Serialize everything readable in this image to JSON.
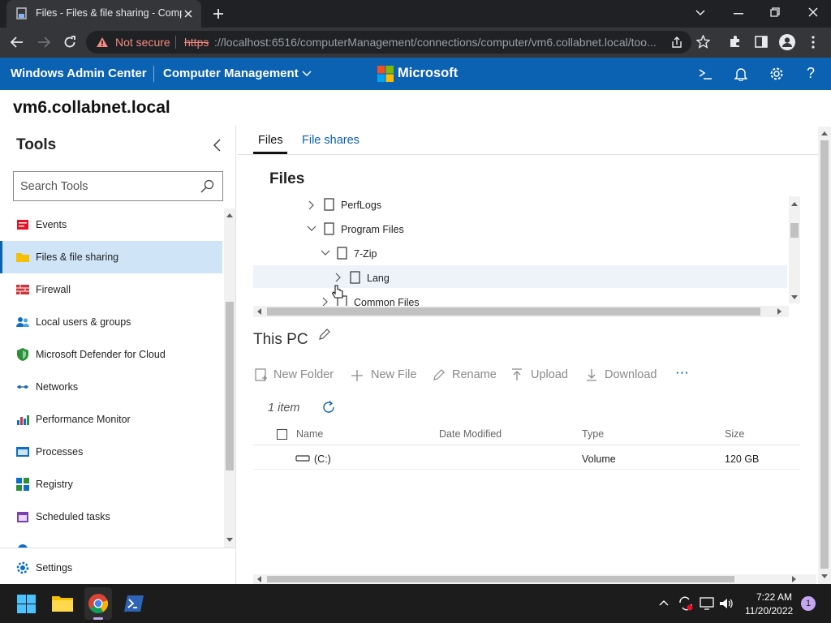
{
  "browser": {
    "tab_title": "Files - Files & file sharing - Comp",
    "not_secure": "Not secure",
    "url_scheme": "https",
    "url_rest": "://localhost:6516/computerManagement/connections/computer/vm6.collabnet.local/too..."
  },
  "header": {
    "app_name": "Windows Admin Center",
    "solution": "Computer Management",
    "brand": "Microsoft"
  },
  "server_name": "vm6.collabnet.local",
  "sidebar": {
    "heading": "Tools",
    "search_placeholder": "Search Tools",
    "items": [
      {
        "label": "Events",
        "icon": "events-icon"
      },
      {
        "label": "Files & file sharing",
        "icon": "folder-icon",
        "selected": true
      },
      {
        "label": "Firewall",
        "icon": "firewall-icon"
      },
      {
        "label": "Local users & groups",
        "icon": "users-icon"
      },
      {
        "label": "Microsoft Defender for Cloud",
        "icon": "shield-icon"
      },
      {
        "label": "Networks",
        "icon": "network-icon"
      },
      {
        "label": "Performance Monitor",
        "icon": "chart-icon"
      },
      {
        "label": "Processes",
        "icon": "process-icon"
      },
      {
        "label": "Registry",
        "icon": "registry-icon"
      },
      {
        "label": "Scheduled tasks",
        "icon": "calendar-icon"
      }
    ],
    "settings": "Settings"
  },
  "tabs": [
    "Files",
    "File shares"
  ],
  "files_heading": "Files",
  "tree": [
    {
      "label": "PerfLogs",
      "expanded": false
    },
    {
      "label": "Program Files",
      "expanded": true
    },
    {
      "label": "7-Zip",
      "expanded": true
    },
    {
      "label": "Lang",
      "expanded": false
    },
    {
      "label": "Common Files",
      "expanded": false
    }
  ],
  "location": "This PC",
  "toolbar": {
    "new_folder": "New Folder",
    "new_file": "New File",
    "rename": "Rename",
    "upload": "Upload",
    "download": "Download",
    "more": "⋯"
  },
  "item_count": "1 item",
  "table": {
    "columns": [
      "Name",
      "Date Modified",
      "Type",
      "Size"
    ],
    "rows": [
      {
        "name": "(C:)",
        "date": "",
        "type": "Volume",
        "size": "120 GB"
      }
    ]
  },
  "taskbar": {
    "time": "7:22 AM",
    "date": "11/20/2022",
    "notifications": "1"
  }
}
